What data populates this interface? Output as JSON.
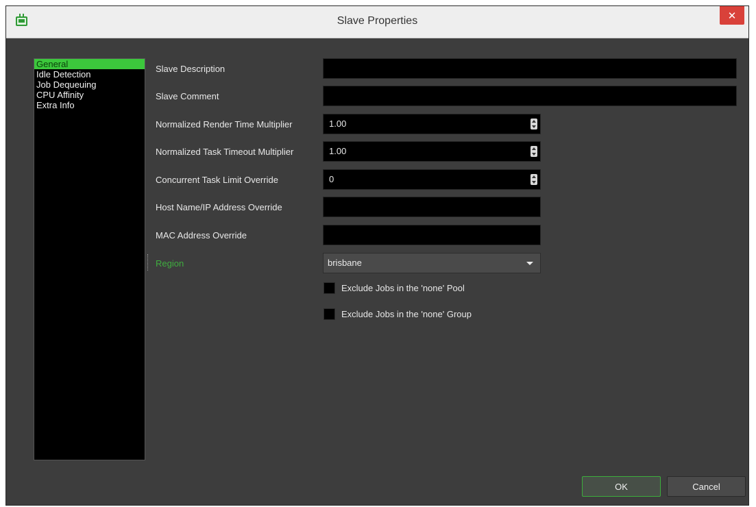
{
  "window": {
    "title": "Slave Properties"
  },
  "sidebar": {
    "items": [
      {
        "label": "General",
        "selected": true
      },
      {
        "label": "Idle Detection"
      },
      {
        "label": "Job Dequeuing"
      },
      {
        "label": "CPU Affinity"
      },
      {
        "label": "Extra Info"
      }
    ]
  },
  "form": {
    "slave_description": {
      "label": "Slave Description",
      "value": ""
    },
    "slave_comment": {
      "label": "Slave Comment",
      "value": ""
    },
    "render_time_multiplier": {
      "label": "Normalized Render Time Multiplier",
      "value": "1.00"
    },
    "task_timeout_multiplier": {
      "label": "Normalized Task Timeout Multiplier",
      "value": "1.00"
    },
    "concurrent_task_limit": {
      "label": "Concurrent Task Limit Override",
      "value": "0"
    },
    "host_override": {
      "label": "Host Name/IP Address Override",
      "value": ""
    },
    "mac_override": {
      "label": "MAC Address Override",
      "value": ""
    },
    "region": {
      "label": "Region",
      "value": "brisbane"
    },
    "exclude_pool": {
      "label": "Exclude Jobs in the 'none' Pool",
      "checked": false
    },
    "exclude_group": {
      "label": "Exclude Jobs in the 'none' Group",
      "checked": false
    }
  },
  "buttons": {
    "ok": "OK",
    "cancel": "Cancel"
  },
  "colors": {
    "accent": "#3cc83c",
    "close": "#d9413a",
    "background": "#3d3d3d"
  }
}
